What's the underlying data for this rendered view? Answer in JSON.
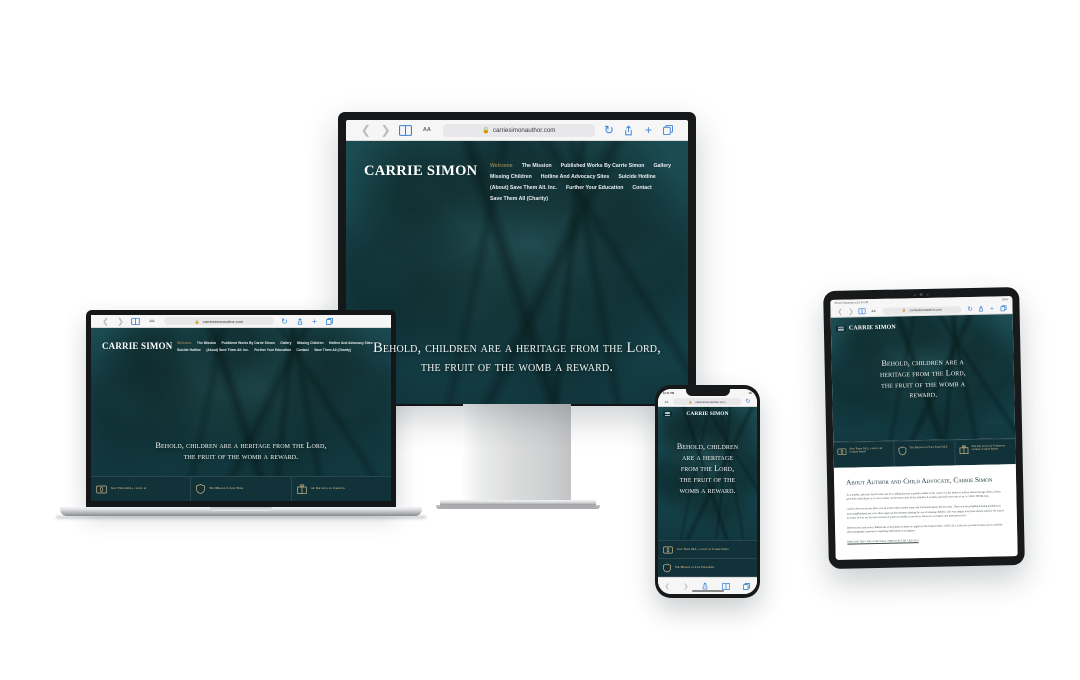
{
  "site": {
    "brand": "CARRIE SIMON",
    "url": "carriesimonauthor.com",
    "aa_label": "AA",
    "nav": [
      {
        "label": "Welcome",
        "active": true
      },
      {
        "label": "The Mission",
        "active": false
      },
      {
        "label": "Published Works By Carrie Simon",
        "active": false
      },
      {
        "label": "Gallery",
        "active": false
      },
      {
        "label": "Missing Children",
        "active": false
      },
      {
        "label": "Hotline And Advocacy Sites",
        "active": false
      },
      {
        "label": "Suicide Hotline",
        "active": false
      },
      {
        "label": "(About) Save Them All. Inc.",
        "active": false
      },
      {
        "label": "Further Your Education",
        "active": false
      },
      {
        "label": "Contact",
        "active": false
      },
      {
        "label": "Save Them All (Charity)",
        "active": false
      }
    ],
    "hero_quote_line1": "Behold, children are a heritage from the Lord,",
    "hero_quote_line2": "the fruit of the womb a reward.",
    "hero_quote_tablet": [
      "Behold, children are a",
      "heritage from the Lord,",
      "the fruit of the womb a",
      "reward."
    ],
    "hero_quote_phone": [
      "Behold, children",
      "are a heritage",
      "from the Lord,",
      "the fruit of the",
      "womb a reward."
    ],
    "features": [
      {
        "icon": "open-book-icon",
        "label": "Save Them ALL, a novel by Carrie Simon",
        "label_short": "Save Them ALL, a novel by"
      },
      {
        "icon": "shield-icon",
        "label": "The Mission to Save Them ALL",
        "label_short": "The Mission to Save Them"
      },
      {
        "icon": "gift-icon",
        "label": "The 3rd novel by Christian author, Carrie Simon",
        "label_short": "the 3rd novel by Christian"
      }
    ],
    "about": {
      "heading": "About Author and Child Advocate, Carrie Simon",
      "paragraphs": [
        "As a mother, advocate has become one of a calling that just a position rather so for Carrie S is her desire to inform and encourage others of how give their child abuse is so every reader can become a part of the solution. It is quite each and every one of us, to SAVE THEM ALL.",
        "Carrie's first two novels place you in a time when murder starts and 'Facebook shares did not exist. There was no googling missing predators in your neighborhood nor were there signs on the doorstep alerting the use of missing children. Life was simply loved has always existed. We wasn't as aware of it as we are now, because it wasn't as readily in our faces. However, it existed, and often perceived.",
        "Between four and seven children die at the hands of abuse or neglect in the United States. SAVE ALL is the two seconds it takes you to read this short paragraph, someone is reporting child abuse to an agency."
      ],
      "underlined": "IMAGINE THE ONES WHO FALL THROUGH THE CRACKS!"
    }
  },
  "phone": {
    "status_time": "10:11 PM",
    "status_right": "4G"
  },
  "tablet": {
    "status_left": "iPhone Saturday at 10:14 PM",
    "status_right": "100%"
  },
  "icons": {
    "back": "back-chevron-icon",
    "forward": "forward-chevron-icon",
    "bookmarks": "bookmarks-icon",
    "reload": "reload-icon",
    "share": "share-icon",
    "new_tab": "new-tab-icon",
    "tabs": "tabs-icon",
    "lock": "lock-icon"
  },
  "colors": {
    "site_teal": "#16444c",
    "accent_gold": "#8e7a52",
    "feature_gold": "#cbb688",
    "chrome_bg": "#f6f6f7",
    "chrome_blue": "#3b82d6",
    "page_bg": "#ffffff"
  }
}
